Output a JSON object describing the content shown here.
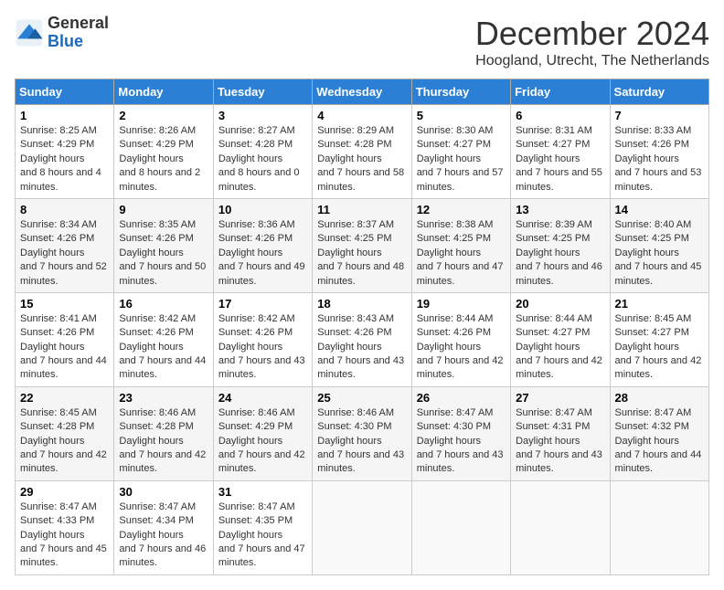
{
  "header": {
    "logo": {
      "line1": "General",
      "line2": "Blue"
    },
    "title": "December 2024",
    "location": "Hoogland, Utrecht, The Netherlands"
  },
  "calendar": {
    "weekdays": [
      "Sunday",
      "Monday",
      "Tuesday",
      "Wednesday",
      "Thursday",
      "Friday",
      "Saturday"
    ],
    "weeks": [
      [
        {
          "day": "1",
          "sunrise": "8:25 AM",
          "sunset": "4:29 PM",
          "daylight": "8 hours and 4 minutes."
        },
        {
          "day": "2",
          "sunrise": "8:26 AM",
          "sunset": "4:29 PM",
          "daylight": "8 hours and 2 minutes."
        },
        {
          "day": "3",
          "sunrise": "8:27 AM",
          "sunset": "4:28 PM",
          "daylight": "8 hours and 0 minutes."
        },
        {
          "day": "4",
          "sunrise": "8:29 AM",
          "sunset": "4:28 PM",
          "daylight": "7 hours and 58 minutes."
        },
        {
          "day": "5",
          "sunrise": "8:30 AM",
          "sunset": "4:27 PM",
          "daylight": "7 hours and 57 minutes."
        },
        {
          "day": "6",
          "sunrise": "8:31 AM",
          "sunset": "4:27 PM",
          "daylight": "7 hours and 55 minutes."
        },
        {
          "day": "7",
          "sunrise": "8:33 AM",
          "sunset": "4:26 PM",
          "daylight": "7 hours and 53 minutes."
        }
      ],
      [
        {
          "day": "8",
          "sunrise": "8:34 AM",
          "sunset": "4:26 PM",
          "daylight": "7 hours and 52 minutes."
        },
        {
          "day": "9",
          "sunrise": "8:35 AM",
          "sunset": "4:26 PM",
          "daylight": "7 hours and 50 minutes."
        },
        {
          "day": "10",
          "sunrise": "8:36 AM",
          "sunset": "4:26 PM",
          "daylight": "7 hours and 49 minutes."
        },
        {
          "day": "11",
          "sunrise": "8:37 AM",
          "sunset": "4:25 PM",
          "daylight": "7 hours and 48 minutes."
        },
        {
          "day": "12",
          "sunrise": "8:38 AM",
          "sunset": "4:25 PM",
          "daylight": "7 hours and 47 minutes."
        },
        {
          "day": "13",
          "sunrise": "8:39 AM",
          "sunset": "4:25 PM",
          "daylight": "7 hours and 46 minutes."
        },
        {
          "day": "14",
          "sunrise": "8:40 AM",
          "sunset": "4:25 PM",
          "daylight": "7 hours and 45 minutes."
        }
      ],
      [
        {
          "day": "15",
          "sunrise": "8:41 AM",
          "sunset": "4:26 PM",
          "daylight": "7 hours and 44 minutes."
        },
        {
          "day": "16",
          "sunrise": "8:42 AM",
          "sunset": "4:26 PM",
          "daylight": "7 hours and 44 minutes."
        },
        {
          "day": "17",
          "sunrise": "8:42 AM",
          "sunset": "4:26 PM",
          "daylight": "7 hours and 43 minutes."
        },
        {
          "day": "18",
          "sunrise": "8:43 AM",
          "sunset": "4:26 PM",
          "daylight": "7 hours and 43 minutes."
        },
        {
          "day": "19",
          "sunrise": "8:44 AM",
          "sunset": "4:26 PM",
          "daylight": "7 hours and 42 minutes."
        },
        {
          "day": "20",
          "sunrise": "8:44 AM",
          "sunset": "4:27 PM",
          "daylight": "7 hours and 42 minutes."
        },
        {
          "day": "21",
          "sunrise": "8:45 AM",
          "sunset": "4:27 PM",
          "daylight": "7 hours and 42 minutes."
        }
      ],
      [
        {
          "day": "22",
          "sunrise": "8:45 AM",
          "sunset": "4:28 PM",
          "daylight": "7 hours and 42 minutes."
        },
        {
          "day": "23",
          "sunrise": "8:46 AM",
          "sunset": "4:28 PM",
          "daylight": "7 hours and 42 minutes."
        },
        {
          "day": "24",
          "sunrise": "8:46 AM",
          "sunset": "4:29 PM",
          "daylight": "7 hours and 42 minutes."
        },
        {
          "day": "25",
          "sunrise": "8:46 AM",
          "sunset": "4:30 PM",
          "daylight": "7 hours and 43 minutes."
        },
        {
          "day": "26",
          "sunrise": "8:47 AM",
          "sunset": "4:30 PM",
          "daylight": "7 hours and 43 minutes."
        },
        {
          "day": "27",
          "sunrise": "8:47 AM",
          "sunset": "4:31 PM",
          "daylight": "7 hours and 43 minutes."
        },
        {
          "day": "28",
          "sunrise": "8:47 AM",
          "sunset": "4:32 PM",
          "daylight": "7 hours and 44 minutes."
        }
      ],
      [
        {
          "day": "29",
          "sunrise": "8:47 AM",
          "sunset": "4:33 PM",
          "daylight": "7 hours and 45 minutes."
        },
        {
          "day": "30",
          "sunrise": "8:47 AM",
          "sunset": "4:34 PM",
          "daylight": "7 hours and 46 minutes."
        },
        {
          "day": "31",
          "sunrise": "8:47 AM",
          "sunset": "4:35 PM",
          "daylight": "7 hours and 47 minutes."
        },
        null,
        null,
        null,
        null
      ]
    ]
  }
}
